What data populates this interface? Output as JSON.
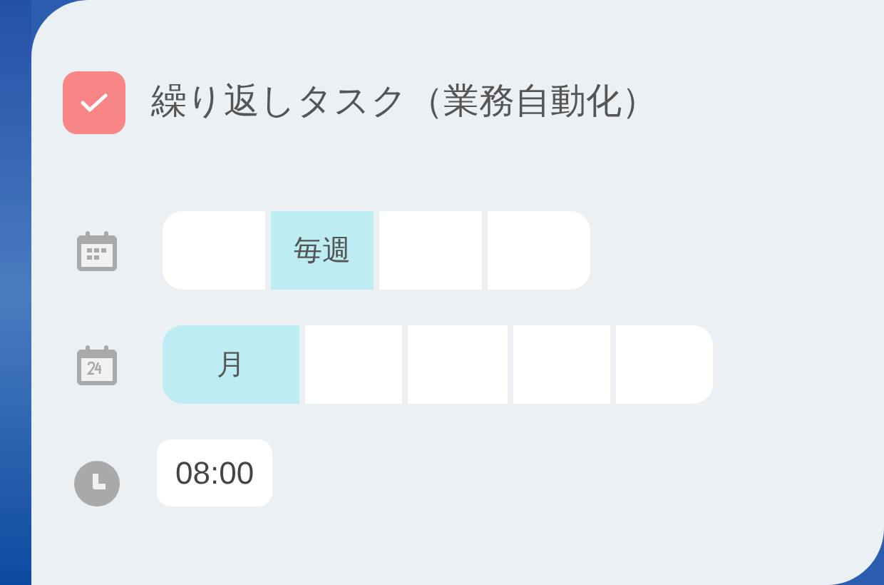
{
  "task": {
    "checked": true,
    "title": "繰り返しタスク（業務自動化）"
  },
  "frequency": [
    {
      "selected": false
    },
    {
      "label": "毎週",
      "selected": true
    },
    {
      "selected": false
    },
    {
      "selected": false
    }
  ],
  "unit": [
    {
      "label": "月",
      "selected": true
    },
    {
      "selected": false
    },
    {
      "selected": false
    },
    {
      "selected": false
    },
    {
      "selected": false
    }
  ],
  "time": {
    "value": "08:00"
  }
}
